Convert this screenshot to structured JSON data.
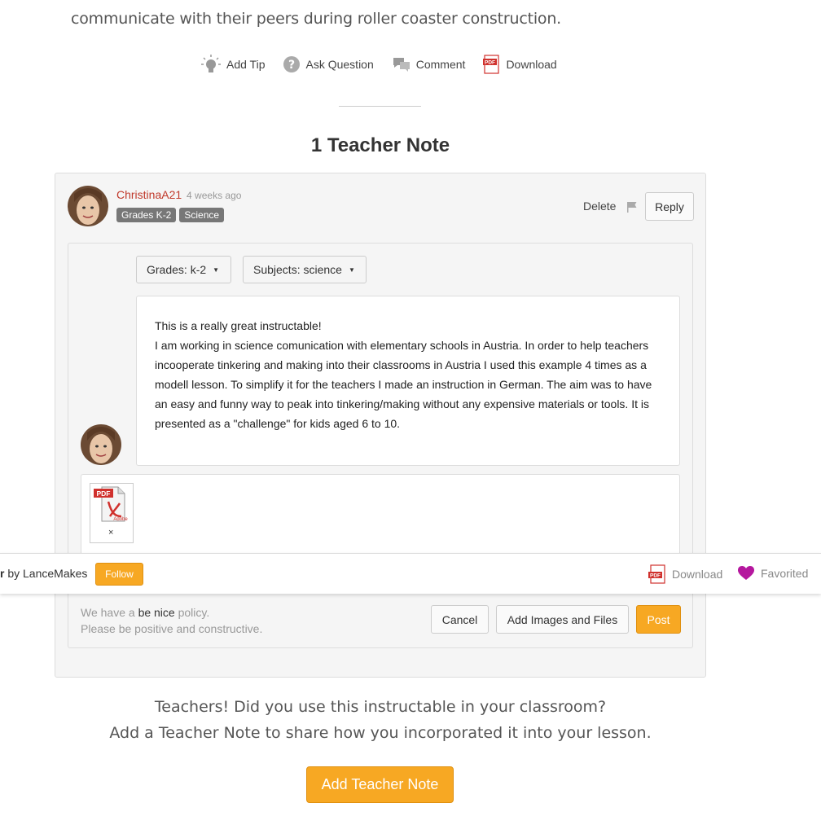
{
  "intro_text": "communicate with their peers during roller coaster construction.",
  "actions": {
    "add_tip": "Add Tip",
    "ask_question": "Ask Question",
    "comment": "Comment",
    "download": "Download"
  },
  "section_title": "1 Teacher Note",
  "note": {
    "author": "ChristinaA21",
    "ago": "4 weeks ago",
    "badges": [
      "Grades K-2",
      "Science"
    ],
    "delete_label": "Delete",
    "reply_label": "Reply"
  },
  "form": {
    "grades_dropdown": "Grades: k-2",
    "subjects_dropdown": "Subjects: science",
    "text_line1": "This is a really great instructable!",
    "text_body": "I am working in science comunication with elementary schools in Austria. In order to help teachers incooperate tinkering and making into their classrooms in Austria I used this example 4 times as a modell lesson. To simplify it for the teachers I made an instruction in German. The aim was to have an easy and funny way to peak into tinkering/making without any expensive materials or tools. It is presented as a \"challenge\" for kids aged 6 to 10.",
    "attachment_label": "PDF",
    "attachment_sub": "Adobe",
    "remove": "×",
    "policy_pre": "We have a ",
    "policy_nice": "be nice",
    "policy_post": " policy.",
    "policy_line2": "Please be positive and constructive.",
    "cancel_label": "Cancel",
    "add_images_label": "Add Images and Files",
    "post_label": "Post"
  },
  "sticky_bar": {
    "title_fragment": "r",
    "by_text": " by LanceMakes",
    "follow_label": "Follow",
    "download_label": "Download",
    "favorited_label": "Favorited"
  },
  "cta": {
    "line1": "Teachers! Did you use this instructable in your classroom?",
    "line2": "Add a Teacher Note to share how you incorporated it into your lesson.",
    "button_label": "Add Teacher Note"
  },
  "colors": {
    "accent": "#f7a823",
    "author_red": "#c0392b",
    "heart": "#b5179e",
    "pdf_red": "#d0312d"
  }
}
